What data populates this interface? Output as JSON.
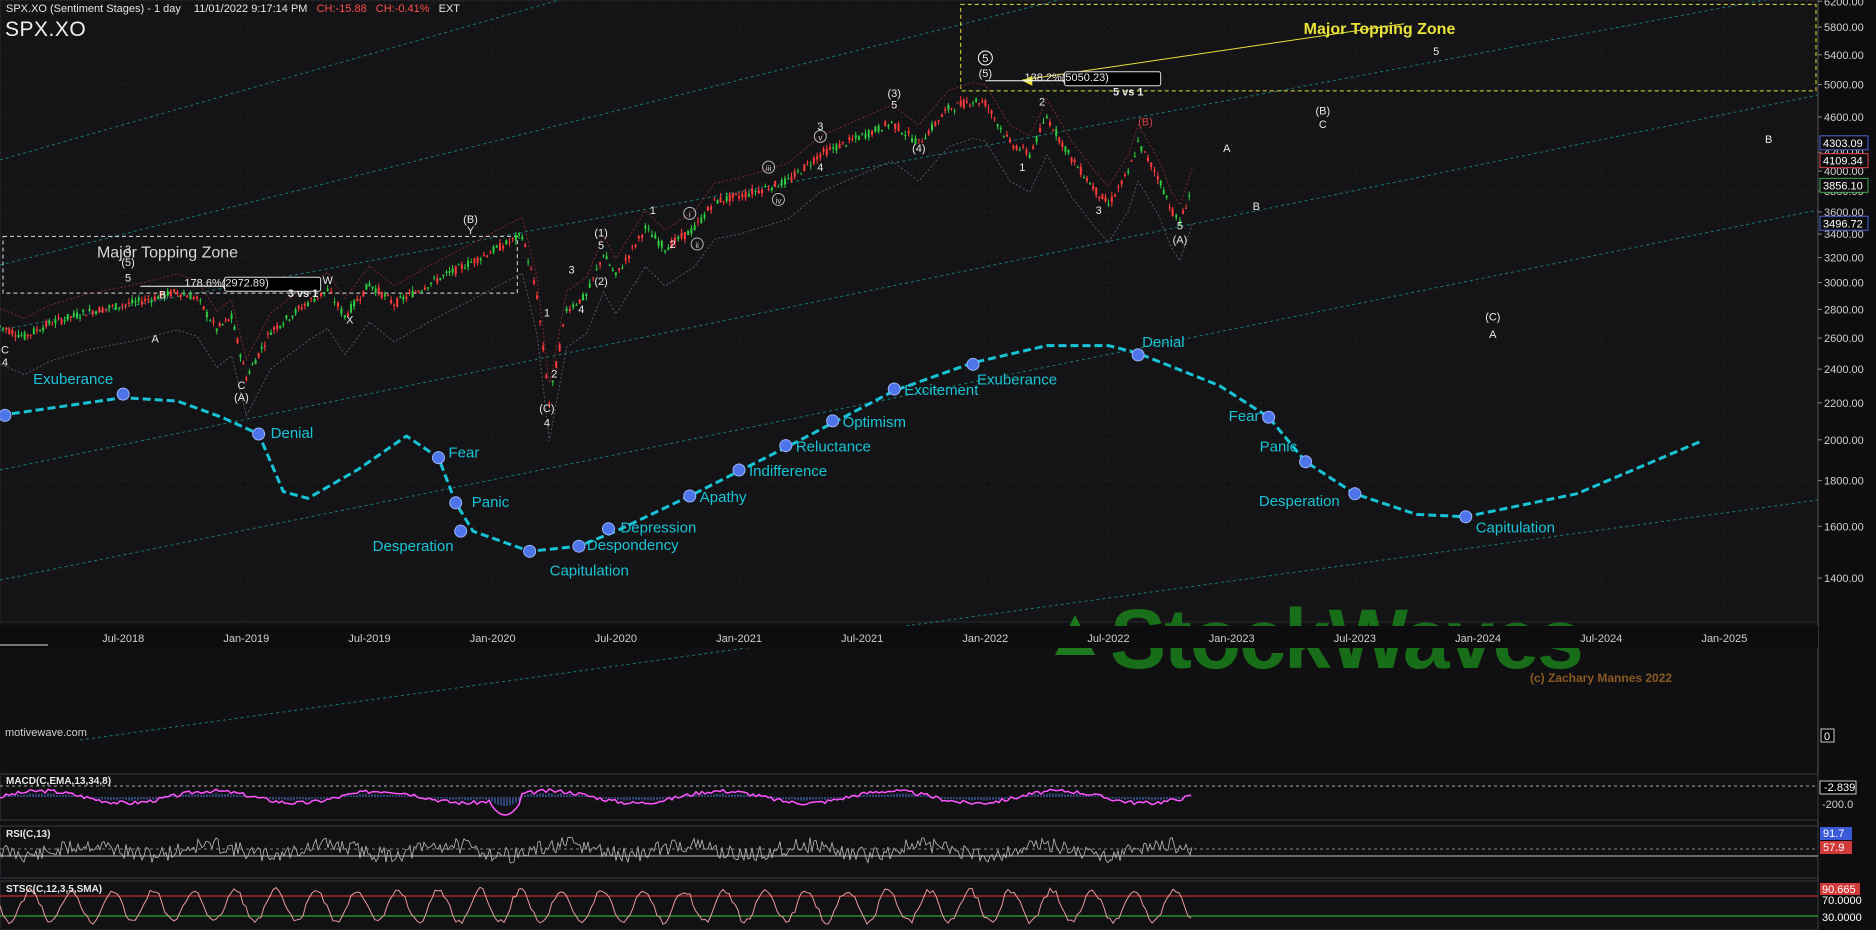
{
  "header": {
    "title": "SPX.XO (Sentiment Stages) - 1 day",
    "datetime": "11/01/2022 9:17:14 PM",
    "change_abs": "CH:-15.88",
    "change_pct": "CH:-0.41%",
    "session": "EXT",
    "symbol": "SPX.XO"
  },
  "watermark": {
    "site": "motivewave.com",
    "brand": "StockWaves",
    "copyright": "(c) Zachary Mannes 2022"
  },
  "colors": {
    "background": "#101012",
    "sentiment_curve": "#19c3d6",
    "node": "#4d74e8",
    "up_candle": "#2ecc40",
    "down_candle": "#ff3b3b",
    "zone": "#e8e23a",
    "channel": "#1aa3a3",
    "macd": "#ff55ff",
    "stoch_over": "#e23c3c",
    "stoch_under": "#3cc83c"
  },
  "chart_data": [
    {
      "type": "line",
      "title": "SPX.XO (Sentiment Stages) - 1 day",
      "y_ticks": [
        6200,
        5800,
        5400,
        5000,
        4600,
        4200,
        4000,
        3800,
        3600,
        3400,
        3200,
        3000,
        2800,
        2600,
        2400,
        2200,
        2000,
        1800,
        1600,
        1400
      ],
      "x_ticks": [
        "Jul-2018",
        "Jan-2019",
        "Jul-2019",
        "Jan-2020",
        "Jul-2020",
        "Jan-2021",
        "Jul-2021",
        "Jan-2022",
        "Jul-2022",
        "Jan-2023",
        "Jul-2023",
        "Jan-2024",
        "Jul-2024",
        "Jan-2025"
      ],
      "x_tick_values": [
        2018.5,
        2019.0,
        2019.5,
        2020.0,
        2020.5,
        2021.0,
        2021.5,
        2022.0,
        2022.5,
        2023.0,
        2023.5,
        2024.0,
        2024.5,
        2025.0
      ],
      "xlim": [
        2018.0,
        2025.38
      ],
      "ylim": [
        1250,
        6220
      ],
      "y_scale": "log",
      "price_path": [
        {
          "x": 2018.0,
          "y": 2680
        },
        {
          "x": 2018.1,
          "y": 2610
        },
        {
          "x": 2018.2,
          "y": 2700
        },
        {
          "x": 2018.35,
          "y": 2780
        },
        {
          "x": 2018.55,
          "y": 2850
        },
        {
          "x": 2018.72,
          "y": 2930
        },
        {
          "x": 2018.8,
          "y": 2880
        },
        {
          "x": 2018.88,
          "y": 2660
        },
        {
          "x": 2018.94,
          "y": 2740
        },
        {
          "x": 2019.0,
          "y": 2350
        },
        {
          "x": 2019.1,
          "y": 2650
        },
        {
          "x": 2019.25,
          "y": 2850
        },
        {
          "x": 2019.33,
          "y": 2940
        },
        {
          "x": 2019.4,
          "y": 2750
        },
        {
          "x": 2019.5,
          "y": 2990
        },
        {
          "x": 2019.6,
          "y": 2840
        },
        {
          "x": 2019.75,
          "y": 3000
        },
        {
          "x": 2019.9,
          "y": 3150
        },
        {
          "x": 2020.12,
          "y": 3390
        },
        {
          "x": 2020.18,
          "y": 2900
        },
        {
          "x": 2020.23,
          "y": 2200
        },
        {
          "x": 2020.3,
          "y": 2800
        },
        {
          "x": 2020.38,
          "y": 2900
        },
        {
          "x": 2020.45,
          "y": 3230
        },
        {
          "x": 2020.5,
          "y": 3050
        },
        {
          "x": 2020.62,
          "y": 3450
        },
        {
          "x": 2020.7,
          "y": 3280
        },
        {
          "x": 2020.82,
          "y": 3450
        },
        {
          "x": 2020.9,
          "y": 3700
        },
        {
          "x": 2021.0,
          "y": 3750
        },
        {
          "x": 2021.2,
          "y": 3900
        },
        {
          "x": 2021.33,
          "y": 4180
        },
        {
          "x": 2021.5,
          "y": 4380
        },
        {
          "x": 2021.62,
          "y": 4530
        },
        {
          "x": 2021.73,
          "y": 4300
        },
        {
          "x": 2021.85,
          "y": 4700
        },
        {
          "x": 2021.95,
          "y": 4800
        },
        {
          "x": 2022.0,
          "y": 4770
        },
        {
          "x": 2022.1,
          "y": 4300
        },
        {
          "x": 2022.18,
          "y": 4180
        },
        {
          "x": 2022.25,
          "y": 4600
        },
        {
          "x": 2022.35,
          "y": 4130
        },
        {
          "x": 2022.45,
          "y": 3800
        },
        {
          "x": 2022.5,
          "y": 3670
        },
        {
          "x": 2022.58,
          "y": 3980
        },
        {
          "x": 2022.62,
          "y": 4300
        },
        {
          "x": 2022.7,
          "y": 3950
        },
        {
          "x": 2022.76,
          "y": 3600
        },
        {
          "x": 2022.79,
          "y": 3500
        },
        {
          "x": 2022.84,
          "y": 3850
        }
      ],
      "price_labels": [
        "4303.09",
        "4109.34",
        "3856.10",
        "3496.72"
      ],
      "right_axis_box": "0",
      "sentiment_stages": [
        {
          "label": "Exuberance",
          "x": 2018.5,
          "y": 2250
        },
        {
          "label": "Denial",
          "x": 2019.05,
          "y": 2030
        },
        {
          "label": "Fear",
          "x": 2019.78,
          "y": 1910
        },
        {
          "label": "Panic",
          "x": 2019.85,
          "y": 1700
        },
        {
          "label": "Desperation",
          "x": 2019.87,
          "y": 1580
        },
        {
          "label": "Capitulation",
          "x": 2020.15,
          "y": 1500
        },
        {
          "label": "Despondency",
          "x": 2020.35,
          "y": 1520
        },
        {
          "label": "Depression",
          "x": 2020.47,
          "y": 1590
        },
        {
          "label": "Apathy",
          "x": 2020.8,
          "y": 1730
        },
        {
          "label": "Indifference",
          "x": 2021.0,
          "y": 1850
        },
        {
          "label": "Reluctance",
          "x": 2021.19,
          "y": 1970
        },
        {
          "label": "Optimism",
          "x": 2021.38,
          "y": 2100
        },
        {
          "label": "Excitement",
          "x": 2021.63,
          "y": 2280
        },
        {
          "label": "Exuberance",
          "x": 2021.95,
          "y": 2430
        },
        {
          "label": "Denial",
          "x": 2022.62,
          "y": 2490
        },
        {
          "label": "Fear",
          "x": 2023.15,
          "y": 2120
        },
        {
          "label": "Panic",
          "x": 2023.3,
          "y": 1890
        },
        {
          "label": "Desperation",
          "x": 2023.5,
          "y": 1740
        },
        {
          "label": "Capitulation",
          "x": 2023.95,
          "y": 1640
        }
      ],
      "sentiment_curve": [
        {
          "x": 2018.0,
          "y": 2130
        },
        {
          "x": 2018.5,
          "y": 2230
        },
        {
          "x": 2018.72,
          "y": 2210
        },
        {
          "x": 2018.9,
          "y": 2120
        },
        {
          "x": 2019.05,
          "y": 2030
        },
        {
          "x": 2019.15,
          "y": 1750
        },
        {
          "x": 2019.25,
          "y": 1720
        },
        {
          "x": 2019.45,
          "y": 1850
        },
        {
          "x": 2019.65,
          "y": 2020
        },
        {
          "x": 2019.78,
          "y": 1910
        },
        {
          "x": 2019.85,
          "y": 1700
        },
        {
          "x": 2019.92,
          "y": 1580
        },
        {
          "x": 2020.15,
          "y": 1500
        },
        {
          "x": 2020.35,
          "y": 1520
        },
        {
          "x": 2020.5,
          "y": 1580
        },
        {
          "x": 2020.8,
          "y": 1730
        },
        {
          "x": 2021.19,
          "y": 1960
        },
        {
          "x": 2021.63,
          "y": 2270
        },
        {
          "x": 2021.95,
          "y": 2440
        },
        {
          "x": 2022.25,
          "y": 2550
        },
        {
          "x": 2022.5,
          "y": 2550
        },
        {
          "x": 2022.62,
          "y": 2500
        },
        {
          "x": 2022.95,
          "y": 2300
        },
        {
          "x": 2023.15,
          "y": 2120
        },
        {
          "x": 2023.3,
          "y": 1890
        },
        {
          "x": 2023.5,
          "y": 1740
        },
        {
          "x": 2023.75,
          "y": 1650
        },
        {
          "x": 2023.95,
          "y": 1640
        },
        {
          "x": 2024.4,
          "y": 1740
        },
        {
          "x": 2024.9,
          "y": 1990
        }
      ],
      "annotations": [
        {
          "text": "Major Topping Zone",
          "x": 2018.68,
          "y": 3200
        },
        {
          "text": "Major Topping Zone",
          "x": 2023.6,
          "y": 5700
        },
        {
          "text": "178.6%(2972.89)",
          "x": 2018.92,
          "y": 2972
        },
        {
          "text": "138.2%(5050.23)",
          "x": 2022.33,
          "y": 5050
        },
        {
          "text": "5 vs 1",
          "x": 2022.58,
          "y": 4860
        },
        {
          "text": "3 vs 1",
          "x": 2019.23,
          "y": 2890
        },
        {
          "text": "(B)",
          "x": 2019.91,
          "y": 3500
        },
        {
          "text": "Y",
          "x": 2019.91,
          "y": 3400
        },
        {
          "text": "(1)",
          "x": 2020.44,
          "y": 3380
        },
        {
          "text": "5",
          "x": 2020.44,
          "y": 3270
        },
        {
          "text": "(2)",
          "x": 2020.44,
          "y": 2980
        },
        {
          "text": "1",
          "x": 2020.22,
          "y": 2750
        },
        {
          "text": "2",
          "x": 2020.25,
          "y": 2350
        },
        {
          "text": "3",
          "x": 2020.32,
          "y": 3070
        },
        {
          "text": "4",
          "x": 2020.36,
          "y": 2775
        },
        {
          "text": "(C)",
          "x": 2020.22,
          "y": 2150
        },
        {
          "text": "4",
          "x": 2020.22,
          "y": 2070
        },
        {
          "text": "1",
          "x": 2020.65,
          "y": 3580
        },
        {
          "text": "2",
          "x": 2020.73,
          "y": 3280
        },
        {
          "text": "i",
          "x": 2020.8,
          "y": 3550
        },
        {
          "text": "ii",
          "x": 2020.83,
          "y": 3280
        },
        {
          "text": "iii",
          "x": 2021.12,
          "y": 4000
        },
        {
          "text": "iv",
          "x": 2021.16,
          "y": 3680
        },
        {
          "text": "3",
          "x": 2021.33,
          "y": 4450
        },
        {
          "text": "v",
          "x": 2021.33,
          "y": 4330
        },
        {
          "text": "4",
          "x": 2021.33,
          "y": 4000
        },
        {
          "text": "(3)",
          "x": 2021.63,
          "y": 4840
        },
        {
          "text": "5",
          "x": 2021.63,
          "y": 4700
        },
        {
          "text": "(4)",
          "x": 2021.73,
          "y": 4200
        },
        {
          "text": "5",
          "x": 2022.0,
          "y": 5300
        },
        {
          "text": "(5)",
          "x": 2022.0,
          "y": 5100
        },
        {
          "text": "2",
          "x": 2022.23,
          "y": 4740
        },
        {
          "text": "1",
          "x": 2022.15,
          "y": 4000
        },
        {
          "text": "3",
          "x": 2022.46,
          "y": 3580
        },
        {
          "text": "(B)",
          "x": 2022.65,
          "y": 4500
        },
        {
          "text": "5",
          "x": 2022.79,
          "y": 3440
        },
        {
          "text": "(A)",
          "x": 2022.79,
          "y": 3320
        },
        {
          "text": "A",
          "x": 2022.98,
          "y": 4200
        },
        {
          "text": "B",
          "x": 2023.1,
          "y": 3620
        },
        {
          "text": "(B)",
          "x": 2023.37,
          "y": 4630
        },
        {
          "text": "C",
          "x": 2023.37,
          "y": 4470
        },
        {
          "text": "5",
          "x": 2023.83,
          "y": 5400
        },
        {
          "text": "(C)",
          "x": 2024.06,
          "y": 2720
        },
        {
          "text": "A",
          "x": 2024.06,
          "y": 2600
        },
        {
          "text": "B",
          "x": 2025.18,
          "y": 4300
        },
        {
          "text": "3",
          "x": 2018.52,
          "y": 3240
        },
        {
          "text": "(5)",
          "x": 2018.52,
          "y": 3130
        },
        {
          "text": "5",
          "x": 2018.52,
          "y": 3010
        },
        {
          "text": "B",
          "x": 2018.66,
          "y": 2880
        },
        {
          "text": "A",
          "x": 2018.63,
          "y": 2570
        },
        {
          "text": "W",
          "x": 2019.33,
          "y": 2990
        },
        {
          "text": "X",
          "x": 2019.42,
          "y": 2700
        },
        {
          "text": "C",
          "x": 2018.98,
          "y": 2280
        },
        {
          "text": "(A)",
          "x": 2018.98,
          "y": 2210
        },
        {
          "text": "C",
          "x": 2018.02,
          "y": 2500
        },
        {
          "text": "4",
          "x": 2018.02,
          "y": 2420
        }
      ]
    },
    {
      "type": "line",
      "title": "MACD(C,EMA,13,34,8)",
      "y_ticks": [
        -200.0
      ],
      "last_value": "-2.839"
    },
    {
      "type": "line",
      "title": "RSI(C,13)",
      "levels": [
        "91.7",
        "57.9"
      ]
    },
    {
      "type": "line",
      "title": "STSC(C,12,3,5,SMA)",
      "levels": [
        "70.0000",
        "30.0000"
      ],
      "last_value": "90.665"
    }
  ]
}
